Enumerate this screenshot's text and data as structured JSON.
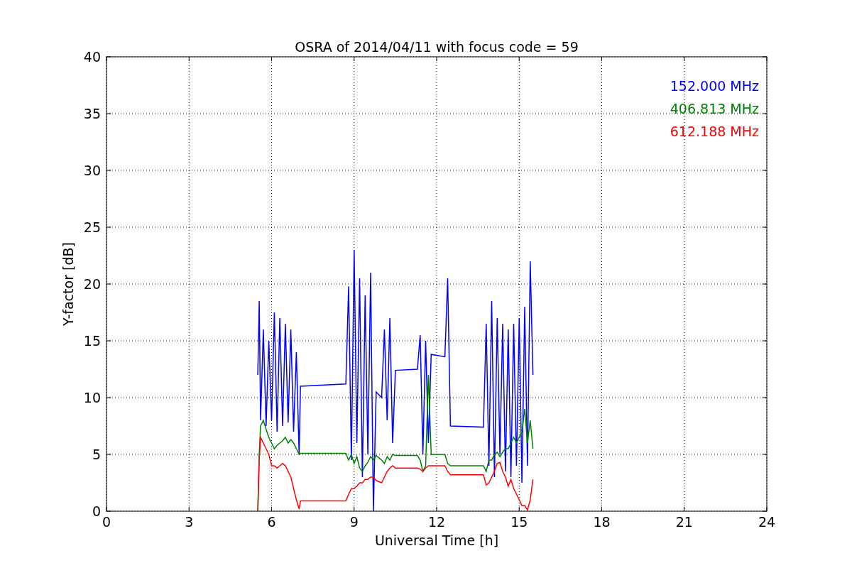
{
  "chart_data": {
    "type": "line",
    "title": "OSRA of 2014/04/11 with focus code = 59",
    "xlabel": "Universal Time [h]",
    "ylabel": "Y-factor [dB]",
    "x": [
      5.5,
      5.55,
      5.6,
      5.7,
      5.8,
      5.9,
      6.0,
      6.1,
      6.2,
      6.3,
      6.4,
      6.5,
      6.6,
      6.7,
      6.8,
      6.9,
      7.0,
      7.05,
      8.7,
      8.8,
      8.9,
      9.0,
      9.1,
      9.2,
      9.3,
      9.4,
      9.5,
      9.6,
      9.7,
      9.8,
      10.0,
      10.1,
      10.2,
      10.3,
      10.4,
      10.5,
      11.3,
      11.4,
      11.5,
      11.6,
      11.7,
      11.8,
      12.3,
      12.4,
      12.5,
      13.7,
      13.8,
      13.9,
      14.0,
      14.1,
      14.2,
      14.3,
      14.4,
      14.5,
      14.6,
      14.7,
      14.8,
      14.9,
      15.0,
      15.1,
      15.2,
      15.3,
      15.4,
      15.5
    ],
    "series": [
      {
        "name": "152.000 MHz",
        "color": "#0000ff",
        "values": [
          12,
          18.5,
          8,
          16,
          7.5,
          15,
          8,
          17.5,
          7,
          17,
          7.5,
          16.5,
          7.8,
          16,
          7,
          14,
          5,
          11,
          11.2,
          19.8,
          4.5,
          23,
          6,
          20.5,
          3,
          19,
          5,
          21,
          0,
          10.5,
          10,
          16,
          8,
          17,
          6,
          12.4,
          12.5,
          15.5,
          5,
          15,
          6,
          13.8,
          13.6,
          20.5,
          7.5,
          7.4,
          16.5,
          4,
          18.5,
          3,
          17,
          5,
          16.5,
          3.5,
          16,
          3,
          16.5,
          4,
          17,
          2.5,
          18,
          4,
          22,
          12
        ]
      },
      {
        "name": "406.813 MHz",
        "color": "#008000",
        "values": [
          0,
          5,
          7.5,
          8,
          7.2,
          6.5,
          6,
          5.5,
          5.8,
          6,
          6.2,
          6.5,
          6,
          6.3,
          6,
          5.5,
          5,
          5.1,
          5.1,
          4.5,
          5,
          4.2,
          4.8,
          3.8,
          3.5,
          4,
          4.3,
          4.8,
          4.5,
          4.9,
          4.5,
          4.2,
          4.8,
          4.5,
          5,
          4.9,
          4.9,
          4.5,
          3.5,
          4,
          12,
          5,
          5,
          4.2,
          4,
          4,
          3.5,
          4.5,
          4.5,
          5,
          5.2,
          4.8,
          5.2,
          5.5,
          5.5,
          6,
          6.5,
          6,
          6.5,
          7,
          9,
          6,
          8,
          5.5
        ]
      },
      {
        "name": "612.188 MHz",
        "color": "#ff0000",
        "values": [
          0,
          4.5,
          6.5,
          6,
          5.5,
          5,
          4,
          4,
          3.8,
          4,
          4.2,
          4,
          3.5,
          3,
          2,
          1,
          0.2,
          0.9,
          0.9,
          1.5,
          2,
          2,
          2.2,
          2.5,
          2.5,
          2.8,
          2.8,
          3,
          3,
          2.7,
          2.5,
          3,
          3.5,
          3.8,
          4,
          3.8,
          3.8,
          3.7,
          3.5,
          3.8,
          4,
          4,
          4,
          3.5,
          3.2,
          3.2,
          2.3,
          2.5,
          3,
          3.5,
          4.2,
          4.3,
          3.5,
          3,
          2.2,
          2.8,
          2,
          1.5,
          1,
          0.5,
          0.5,
          0.1,
          1,
          2.8
        ]
      }
    ],
    "grid": true,
    "xlim": [
      0,
      24
    ],
    "ylim": [
      0,
      40
    ],
    "xticks": [
      0,
      3,
      6,
      9,
      12,
      15,
      18,
      21,
      24
    ],
    "yticks": [
      0,
      5,
      10,
      15,
      20,
      25,
      30,
      35,
      40
    ]
  }
}
